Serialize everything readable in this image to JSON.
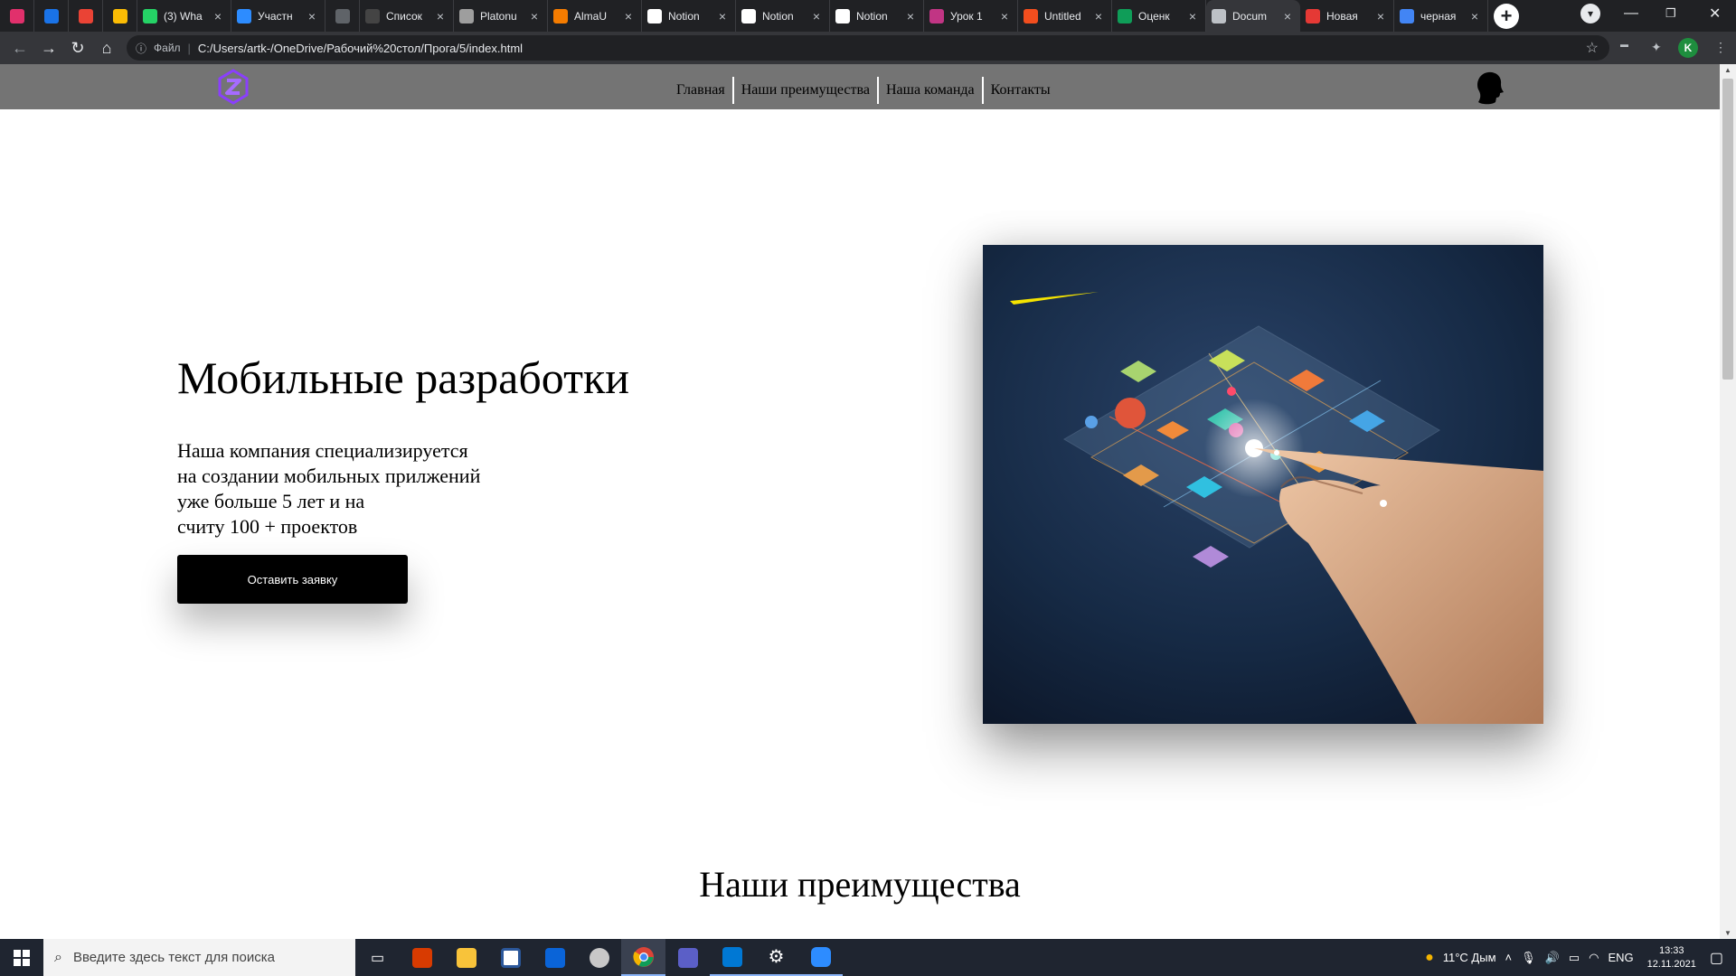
{
  "browser": {
    "tabs": [
      {
        "title": "",
        "pinned": true,
        "icon": "instagram-icon",
        "color": "#e1306c"
      },
      {
        "title": "",
        "pinned": true,
        "icon": "messenger-icon",
        "color": "#1a73e8"
      },
      {
        "title": "",
        "pinned": true,
        "icon": "gmail-icon",
        "color": "#ea4335"
      },
      {
        "title": "",
        "pinned": true,
        "icon": "google-drive-icon",
        "color": "#fbbc04"
      },
      {
        "title": "(3) Wha",
        "icon": "whatsapp-icon",
        "color": "#25d366"
      },
      {
        "title": "Участн",
        "icon": "zoom-icon",
        "color": "#2d8cff"
      },
      {
        "title": "",
        "pinned": true,
        "icon": "blank-page-icon",
        "color": "#5f6368"
      },
      {
        "title": "Список",
        "icon": "google-classroom-icon",
        "color": "#444444"
      },
      {
        "title": "Platonu",
        "icon": "platonus-icon",
        "color": "#9e9e9e"
      },
      {
        "title": "AlmaU",
        "icon": "almau-icon",
        "color": "#f57c00"
      },
      {
        "title": "Notion",
        "icon": "notion-icon",
        "color": "#ffffff"
      },
      {
        "title": "Notion",
        "icon": "notion-icon",
        "color": "#ffffff"
      },
      {
        "title": "Notion",
        "icon": "notion-icon",
        "color": "#ffffff"
      },
      {
        "title": "Урок 1",
        "icon": "instagram-icon",
        "color": "#c13584"
      },
      {
        "title": "Untitled",
        "icon": "figma-icon",
        "color": "#f24e1e"
      },
      {
        "title": "Оценк",
        "icon": "google-sheets-icon",
        "color": "#0f9d58"
      },
      {
        "title": "Docum",
        "icon": "globe-icon",
        "color": "#bdc1c6",
        "active": true
      },
      {
        "title": "Новая",
        "icon": "star-badge-icon",
        "color": "#e53935"
      },
      {
        "title": "черная",
        "icon": "google-icon",
        "color": "#4285f4"
      }
    ],
    "omnibox": {
      "scheme_label": "Файл",
      "url": "C:/Users/artk-/OneDrive/Рабочий%20стол/Прога/5/index.html"
    },
    "profile_initial": "K"
  },
  "site": {
    "nav": [
      "Главная",
      "Наши преимущества",
      "Наша команда",
      "Контакты"
    ],
    "logo_color": "#8a3ffc",
    "hero": {
      "title": "Мобильные разработки",
      "text_lines": [
        "Наша компания специализируется",
        "на создании мобильных прилжений",
        "уже больше 5 лет и на",
        "считу 100 + проектов"
      ],
      "button": "Оставить заявку"
    },
    "section_title": "Наши преимущества"
  },
  "taskbar": {
    "search_placeholder": "Введите здесь текст для поиска",
    "weather": "11°C  Дым",
    "language": "ENG",
    "time": "13:33",
    "date": "12.11.2021"
  }
}
